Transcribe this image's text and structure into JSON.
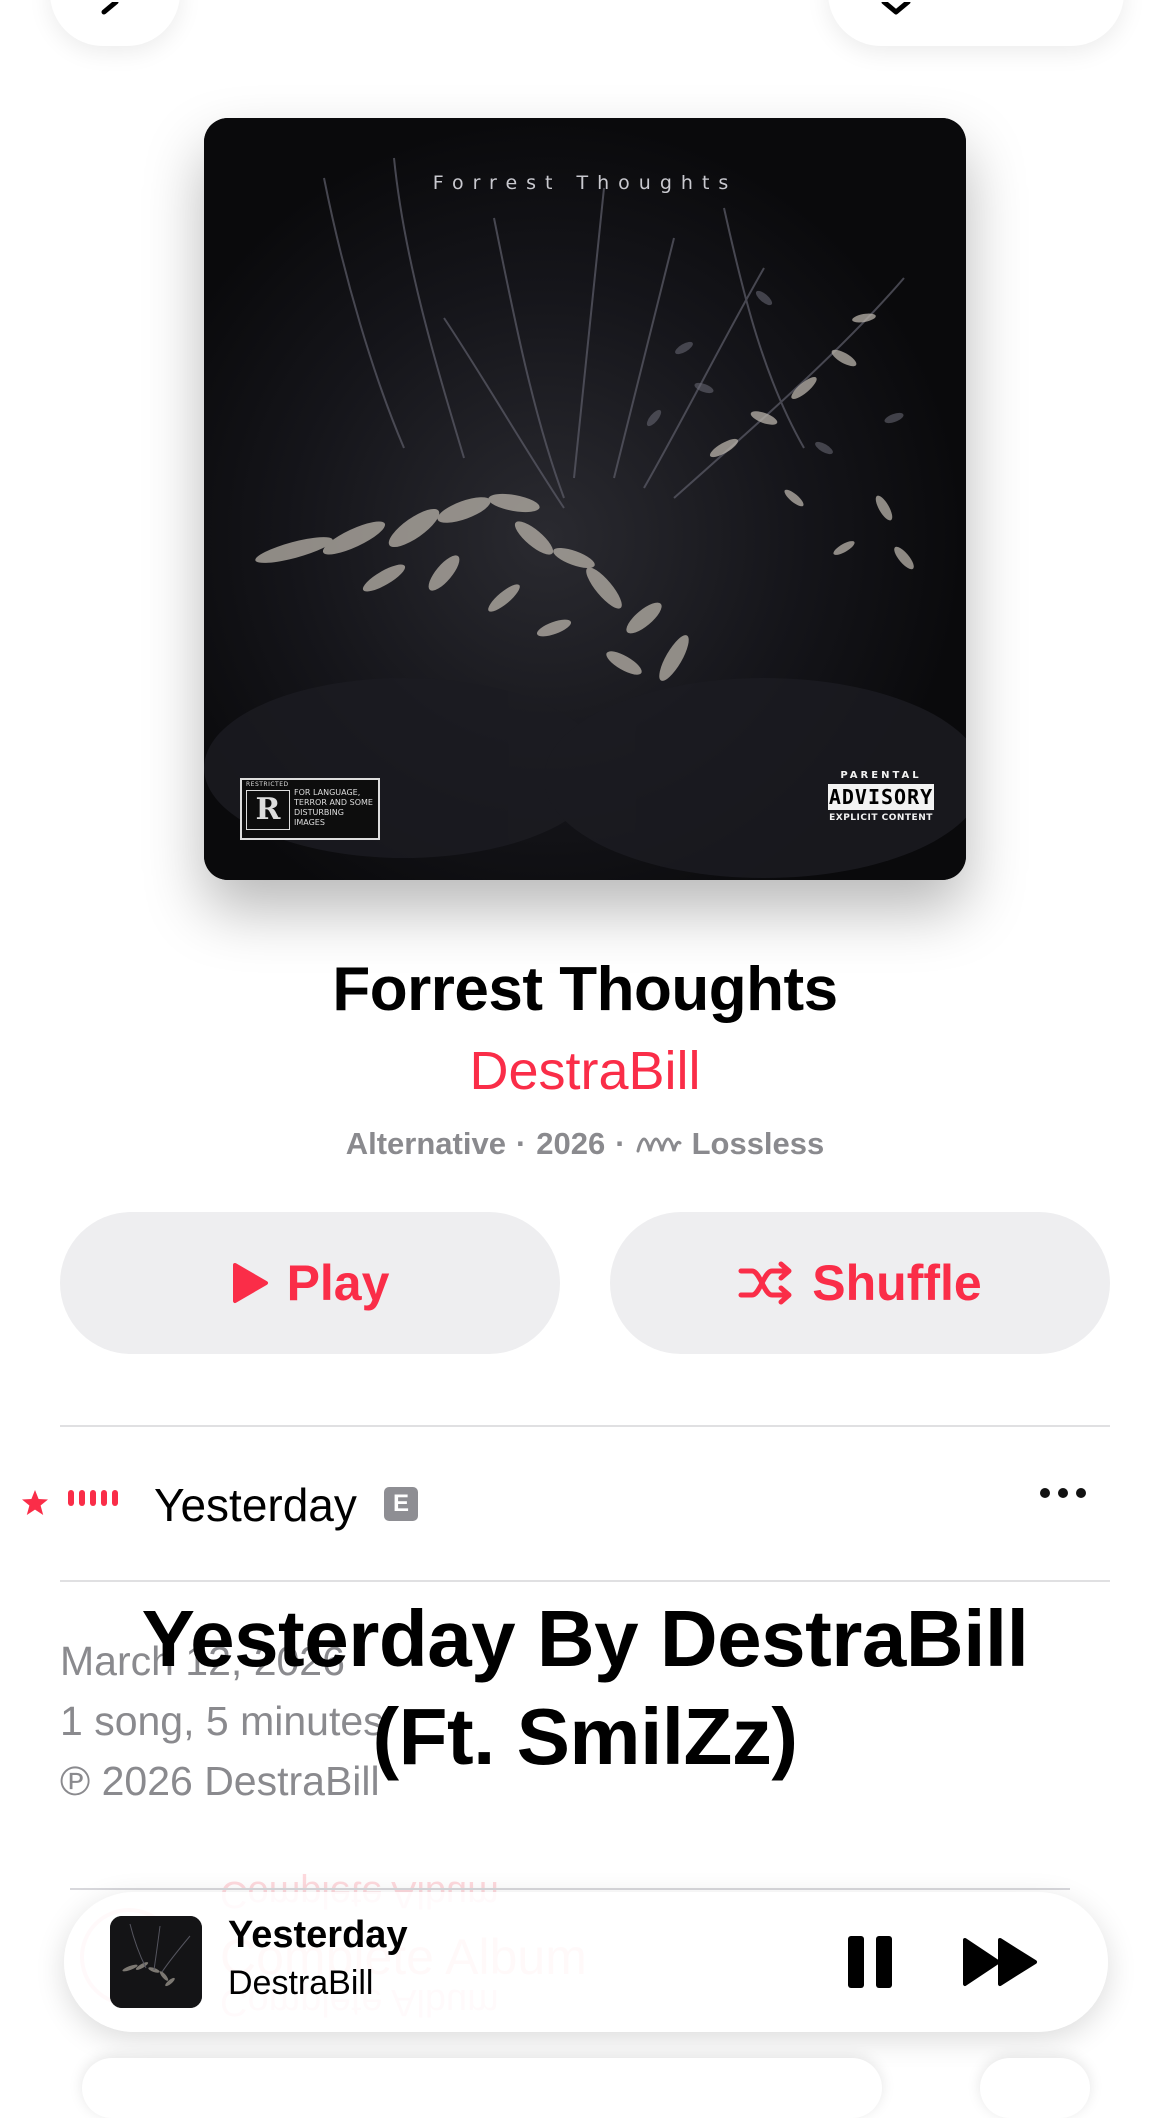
{
  "artwork": {
    "title_text": "Forrest Thoughts",
    "rating": {
      "letter": "R",
      "header": "RESTRICTED",
      "reason": "FOR LANGUAGE, TERROR AND SOME DISTURBING IMAGES"
    },
    "advisory": {
      "line1": "PARENTAL",
      "line2": "ADVISORY",
      "line3": "EXPLICIT CONTENT"
    }
  },
  "album": {
    "title": "Forrest Thoughts",
    "artist": "DestraBill",
    "genre": "Alternative",
    "year": "2026",
    "separator": "·",
    "quality": "Lossless"
  },
  "actions": {
    "play_label": "Play",
    "shuffle_label": "Shuffle"
  },
  "tracks": [
    {
      "title": "Yesterday",
      "explicit_badge": "E"
    }
  ],
  "release": {
    "date": "March 12, 2026",
    "summary": "1 song, 5 minutes",
    "copyright": "℗ 2026 DestraBill"
  },
  "caption": {
    "line1": "Yesterday By DestraBill",
    "line2": "(Ft. SmilZz)"
  },
  "hidden_row": {
    "label": "Complete Album"
  },
  "now_playing": {
    "title": "Yesterday",
    "artist": "DestraBill"
  },
  "colors": {
    "accent": "#fa2d48",
    "secondary_text": "#8a8a8e",
    "button_bg": "#eeeef0"
  },
  "icons": {
    "play": "play-icon",
    "shuffle": "shuffle-icon",
    "lossless": "lossless-icon",
    "favorite": "star-icon",
    "now_playing": "waveform-icon",
    "more": "ellipsis-icon",
    "pause": "pause-icon",
    "next": "forward-icon"
  }
}
